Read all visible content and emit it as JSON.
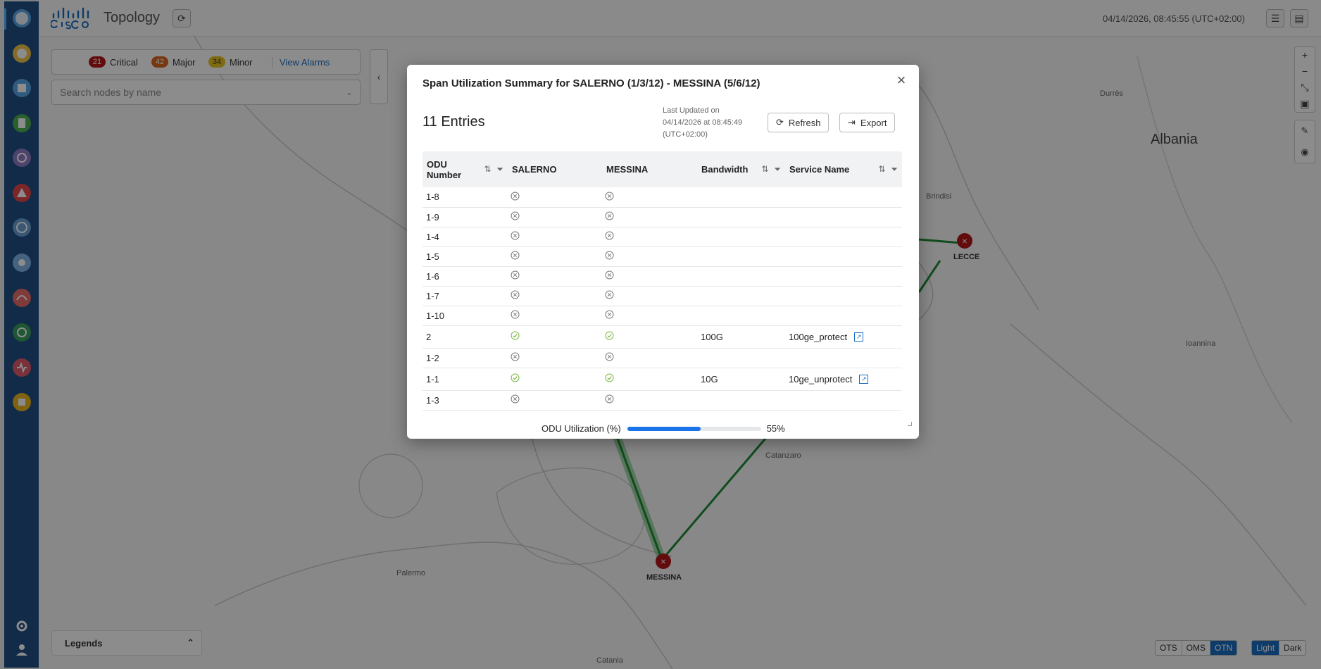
{
  "header": {
    "title": "Topology",
    "timestamp": "04/14/2026, 08:45:55 (UTC+02:00)"
  },
  "alarms": {
    "critical": {
      "count": "21",
      "label": "Critical",
      "color": "#b3161b"
    },
    "major": {
      "count": "42",
      "label": "Major",
      "color": "#d9661f"
    },
    "minor": {
      "count": "34",
      "label": "Minor",
      "color": "#e8c41f"
    },
    "view_label": "View Alarms"
  },
  "search": {
    "placeholder": "Search nodes by name"
  },
  "map": {
    "labels": {
      "albania": "Albania",
      "durres": "Durrës",
      "brindisi": "Brindisi",
      "lecce": "LECCE",
      "ioannina": "Ioannina",
      "catanzaro": "Catanzaro",
      "palermo": "Palermo",
      "messina": "MESSINA",
      "catania": "Catania"
    }
  },
  "legends": {
    "label": "Legends"
  },
  "layers": {
    "ots": "OTS",
    "oms": "OMS",
    "otn": "OTN",
    "active": "OTN"
  },
  "theme": {
    "light": "Light",
    "dark": "Dark",
    "active": "Light"
  },
  "modal": {
    "title": "Span Utilization Summary for SALERNO (1/3/12) - MESSINA (5/6/12)",
    "entries": "11 Entries",
    "last_updated_label": "Last Updated on",
    "last_updated_value": "04/14/2026 at 08:45:49",
    "last_updated_tz": "(UTC+02:00)",
    "refresh_label": "Refresh",
    "export_label": "Export",
    "columns": {
      "odu_line1": "ODU",
      "odu_line2": "Number",
      "salerno": "SALERNO",
      "messina": "MESSINA",
      "bandwidth": "Bandwidth",
      "service": "Service Name"
    },
    "rows": [
      {
        "odu": "1-8",
        "salerno": "unused",
        "messina": "unused",
        "bandwidth": "",
        "service": ""
      },
      {
        "odu": "1-9",
        "salerno": "unused",
        "messina": "unused",
        "bandwidth": "",
        "service": ""
      },
      {
        "odu": "1-4",
        "salerno": "unused",
        "messina": "unused",
        "bandwidth": "",
        "service": ""
      },
      {
        "odu": "1-5",
        "salerno": "unused",
        "messina": "unused",
        "bandwidth": "",
        "service": ""
      },
      {
        "odu": "1-6",
        "salerno": "unused",
        "messina": "unused",
        "bandwidth": "",
        "service": ""
      },
      {
        "odu": "1-7",
        "salerno": "unused",
        "messina": "unused",
        "bandwidth": "",
        "service": ""
      },
      {
        "odu": "1-10",
        "salerno": "unused",
        "messina": "unused",
        "bandwidth": "",
        "service": ""
      },
      {
        "odu": "2",
        "salerno": "used",
        "messina": "used",
        "bandwidth": "100G",
        "service": "100ge_protect"
      },
      {
        "odu": "1-2",
        "salerno": "unused",
        "messina": "unused",
        "bandwidth": "",
        "service": ""
      },
      {
        "odu": "1-1",
        "salerno": "used",
        "messina": "used",
        "bandwidth": "10G",
        "service": "10ge_unprotect"
      },
      {
        "odu": "1-3",
        "salerno": "unused",
        "messina": "unused",
        "bandwidth": "",
        "service": ""
      }
    ],
    "utilization_label": "ODU Utilization (%)",
    "utilization_value": "55%",
    "utilization_fraction": 0.55
  }
}
